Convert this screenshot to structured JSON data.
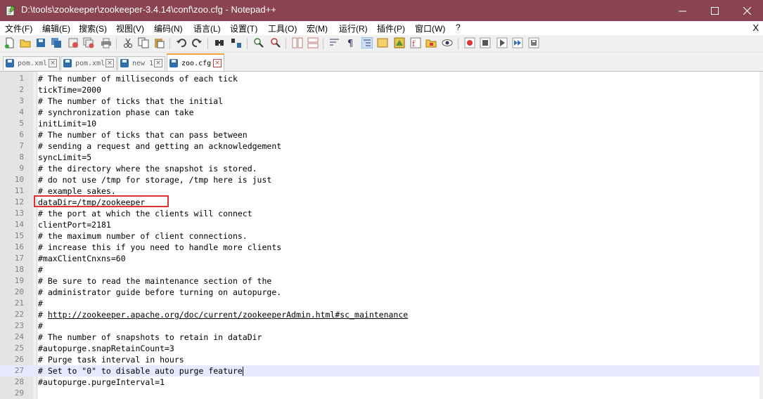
{
  "window": {
    "title": "D:\\tools\\zookeeper\\zookeeper-3.4.14\\conf\\zoo.cfg - Notepad++",
    "app_icon": "notepad-icon",
    "controls": [
      "minimize-icon",
      "maximize-icon",
      "close-icon"
    ]
  },
  "menu": {
    "items": [
      "文件(F)",
      "编辑(E)",
      "搜索(S)",
      "视图(V)",
      "编码(N)",
      "语言(L)",
      "设置(T)",
      "工具(O)",
      "宏(M)",
      "运行(R)",
      "插件(P)",
      "窗口(W)",
      "?"
    ],
    "close_label": "X"
  },
  "toolbar": {
    "icons": [
      "new-file-icon",
      "open-file-icon",
      "save-icon",
      "save-all-icon",
      "close-icon",
      "close-all-icon",
      "print-icon",
      "cut-icon",
      "copy-icon",
      "paste-icon",
      "undo-icon",
      "redo-icon",
      "find-icon",
      "replace-icon",
      "zoom-in-icon",
      "zoom-out-icon",
      "sync-vertical-icon",
      "sync-horizontal-icon",
      "word-wrap-icon",
      "show-all-chars-icon",
      "indent-guide-icon",
      "language-icon",
      "doc-map-icon",
      "function-list-icon",
      "folder-workspace-icon",
      "monitor-icon",
      "record-macro-icon",
      "stop-macro-icon",
      "play-macro-icon",
      "run-macro-multiple-icon",
      "save-macro-icon"
    ]
  },
  "tabs": [
    {
      "label": "pom.xml",
      "active": false
    },
    {
      "label": "pom.xml",
      "active": false
    },
    {
      "label": "new 1",
      "active": false
    },
    {
      "label": "zoo.cfg",
      "active": true
    }
  ],
  "tab_close_glyph": "×",
  "editor": {
    "current_line": 27,
    "highlighted_line": 12,
    "lines": [
      "# The number of milliseconds of each tick",
      "tickTime=2000",
      "# The number of ticks that the initial",
      "# synchronization phase can take",
      "initLimit=10",
      "# The number of ticks that can pass between",
      "# sending a request and getting an acknowledgement",
      "syncLimit=5",
      "# the directory where the snapshot is stored.",
      "# do not use /tmp for storage, /tmp here is just",
      "# example sakes.",
      "dataDir=/tmp/zookeeper",
      "# the port at which the clients will connect",
      "clientPort=2181",
      "# the maximum number of client connections.",
      "# increase this if you need to handle more clients",
      "#maxClientCnxns=60",
      "#",
      "# Be sure to read the maintenance section of the",
      "# administrator guide before turning on autopurge.",
      "#",
      "# http://zookeeper.apache.org/doc/current/zookeeperAdmin.html#sc_maintenance",
      "#",
      "# The number of snapshots to retain in dataDir",
      "#autopurge.snapRetainCount=3",
      "# Purge task interval in hours",
      "# Set to \"0\" to disable auto purge feature",
      "#autopurge.purgeInterval=1",
      ""
    ],
    "line_numbers": [
      "1",
      "2",
      "3",
      "4",
      "5",
      "6",
      "7",
      "8",
      "9",
      "10",
      "11",
      "12",
      "13",
      "14",
      "15",
      "16",
      "17",
      "18",
      "19",
      "20",
      "21",
      "22",
      "23",
      "24",
      "25",
      "26",
      "27",
      "28",
      "29"
    ],
    "link": {
      "prefix": "# ",
      "url": "http://zookeeper.apache.org/doc/current/zookeeperAdmin.html#sc_maintenance"
    }
  },
  "colors": {
    "titlebar": "#8a4350",
    "highlight_box": "#e03030",
    "active_tab_accent": "#f2a33a",
    "current_line_bg": "#e8e8ff"
  }
}
